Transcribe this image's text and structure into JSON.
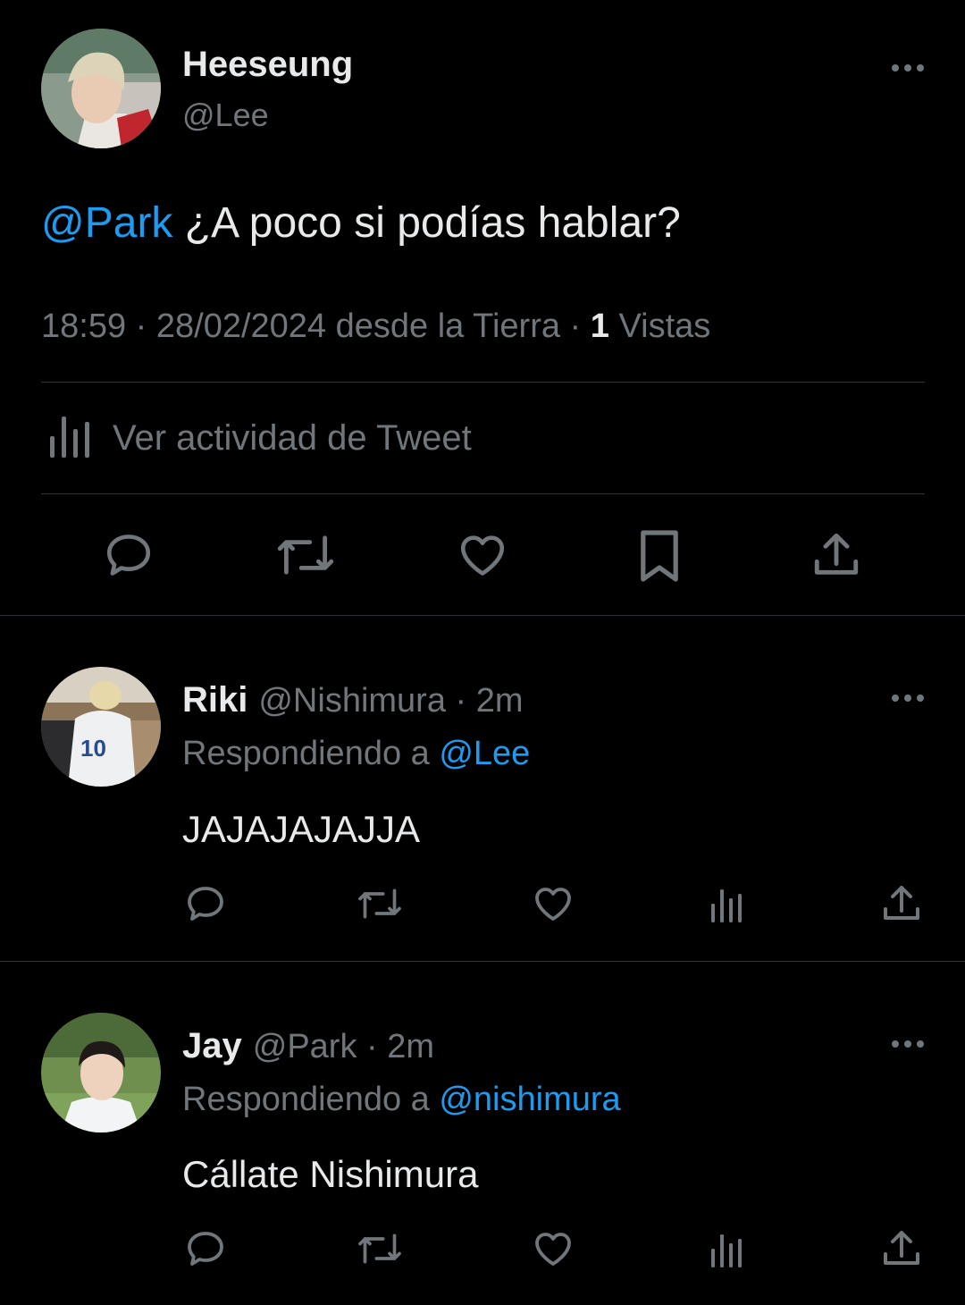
{
  "main_tweet": {
    "author_name": "Heeseung",
    "author_handle": "@Lee",
    "mention": "@Park",
    "text": " ¿A poco si podías hablar?",
    "time": "18:59",
    "date": "28/02/2024",
    "source": "desde la Tierra",
    "sep": " · ",
    "views_count": "1",
    "views_label": " Vistas",
    "activity_label": "Ver actividad de Tweet",
    "actions": [
      "reply-icon",
      "retweet-icon",
      "like-icon",
      "bookmark-icon",
      "share-icon"
    ]
  },
  "replies": [
    {
      "name": "Riki",
      "handle": "@Nishimura",
      "time": "· 2m",
      "replying_prefix": "Respondiendo a ",
      "replying_to": "@Lee",
      "text": "JAJAJAJAJJA"
    },
    {
      "name": "Jay",
      "handle": "@Park",
      "time": "· 2m",
      "replying_prefix": "Respondiendo a ",
      "replying_to": "@nishimura",
      "text": "Cállate Nishimura"
    }
  ],
  "colors": {
    "background": "#000000",
    "text": "#e7e9ea",
    "muted": "#71767b",
    "link": "#1d9bf0",
    "divider": "#2f3336"
  }
}
